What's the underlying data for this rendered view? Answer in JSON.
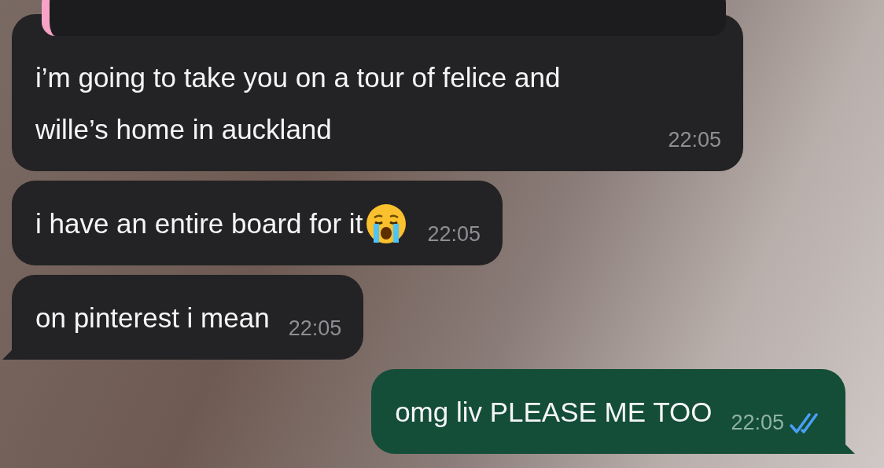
{
  "messages": [
    {
      "kind": "incoming",
      "text": "i’m going to take you on a tour of felice and wille’s home in auckland",
      "time": "22:05",
      "quoted": true,
      "emoji": false,
      "tail": false
    },
    {
      "kind": "incoming",
      "text": "i have an entire board for it",
      "time": "22:05",
      "quoted": false,
      "emoji": true,
      "tail": false
    },
    {
      "kind": "incoming",
      "text": "on pinterest i mean",
      "time": "22:05",
      "quoted": false,
      "emoji": false,
      "tail": true
    },
    {
      "kind": "outgoing",
      "text": "omg liv PLEASE ME TOO",
      "time": "22:05",
      "quoted": false,
      "emoji": false,
      "tail": true,
      "read": true
    }
  ]
}
